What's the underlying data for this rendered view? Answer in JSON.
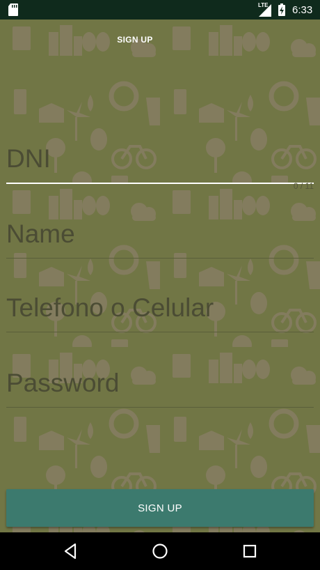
{
  "status_bar": {
    "network": "LTE",
    "time": "6:33",
    "icons": [
      "sd-card-icon",
      "signal-icon",
      "battery-charging-icon"
    ]
  },
  "header": {
    "title": "SIGN UP"
  },
  "form": {
    "dni": {
      "placeholder": "DNI",
      "value": "",
      "counter": "0 / 11"
    },
    "name": {
      "placeholder": "Name",
      "value": ""
    },
    "phone": {
      "placeholder": "Telefono o Celular",
      "value": ""
    },
    "password": {
      "placeholder": "Password",
      "value": ""
    }
  },
  "actions": {
    "signup_label": "SIGN UP"
  },
  "nav": {
    "icons": [
      "back-icon",
      "home-icon",
      "recents-icon"
    ]
  },
  "colors": {
    "background": "#717645",
    "pattern": "#8f8070",
    "button": "#3c7a6e",
    "status_bar": "#0f2a1c"
  }
}
